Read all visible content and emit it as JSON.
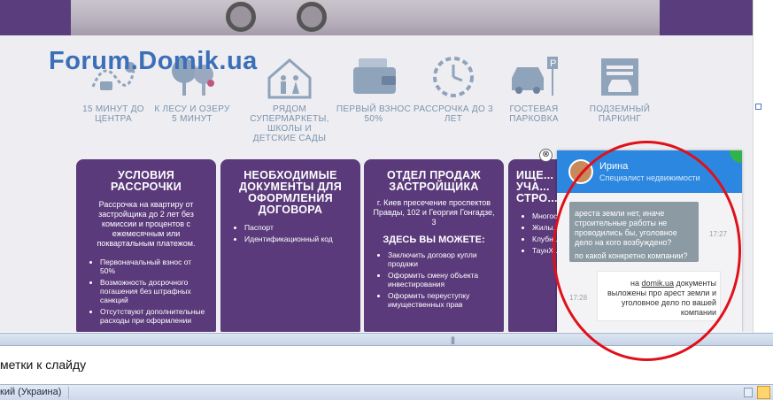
{
  "watermark": "Forum.Domik.ua",
  "features": [
    {
      "icon": "map-route-icon",
      "label": "15 минут до центра"
    },
    {
      "icon": "trees-icon",
      "label": "к лесу и озеру 5 минут"
    },
    {
      "icon": "family-house-icon",
      "label": "рядом супермаркеты, школы и детские сады"
    },
    {
      "icon": "wallet-icon",
      "label": "первый взнос 50%"
    },
    {
      "icon": "clock-icon",
      "label": "рассрочка до 3 лет"
    },
    {
      "icon": "car-parking-icon",
      "label": "гостевая парковка"
    },
    {
      "icon": "garage-icon",
      "label": "подземный паркинг"
    }
  ],
  "cards": [
    {
      "title": "Условия рассрочки",
      "text": "Рассрочка на квартиру от застройщика до 2 лет без комиссии и процентов с ежемесячным или поквартальным платежом.",
      "items": [
        "Первоначальный взнос от 50%",
        "Возможность досрочного погашения без штрафных санкций",
        "Отсутствуют дополнительные расходы при оформлении"
      ]
    },
    {
      "title": "Необходимые документы для оформления договора",
      "items": [
        "Паспорт",
        "Идентификационный код"
      ]
    },
    {
      "title": "Отдел продаж застройщика",
      "text": "г. Киев пресечение проспектов Правды, 102 и Георгия Гонгадзе, 3",
      "subtitle": "Здесь вы можете:",
      "items": [
        "Заключить договор купли продажи",
        "Оформить смену объекта инвестирования",
        "Оформить переуступку имущественных прав"
      ]
    },
    {
      "title": "Ище... уча... стро...",
      "items": [
        "Многос... компл...",
        "Жилы... компл...",
        "Клубн...",
        "ТаунХ..."
      ]
    }
  ],
  "chat": {
    "agent_name": "Ирина",
    "agent_role": "Специалист недвижимости",
    "close_glyph": "⊗",
    "incoming": {
      "text": "ареста земли нет, иначе строительные работы не проводились бы, уголовное дело на кого возбуждено?",
      "text2": "по какой конкретно компании?",
      "time": "17:27"
    },
    "outgoing": {
      "prefix": "на ",
      "link": "domik.ua",
      "suffix": " документы выложены про арест земли и уголовное дело по вашей компании",
      "time": "17:28"
    }
  },
  "notes": {
    "text": "метки к слайду"
  },
  "status": {
    "language": "кий (Украина)"
  },
  "colors": {
    "card_bg": "#5a3a7a",
    "chat_header": "#2b87e0",
    "annotation": "#e0101a"
  }
}
